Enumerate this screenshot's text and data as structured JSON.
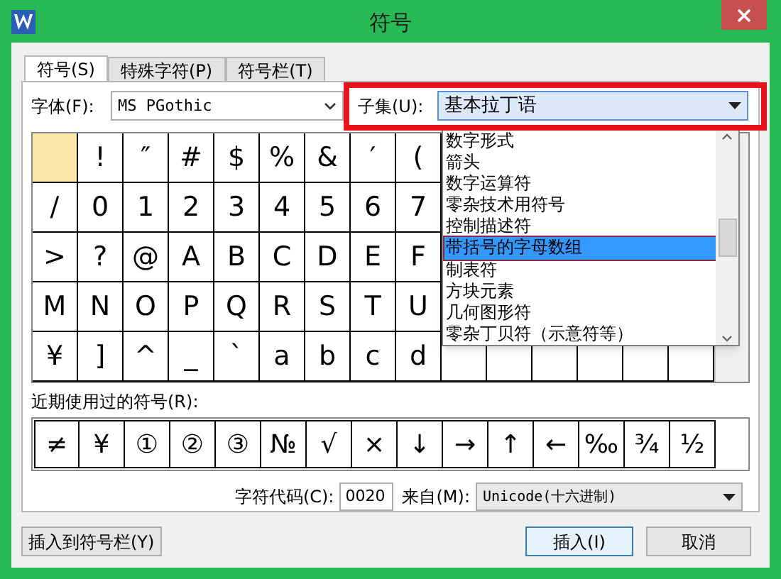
{
  "window": {
    "title": "符号"
  },
  "tabs": [
    {
      "label": "符号(S)",
      "selected": true
    },
    {
      "label": "特殊字符(P)",
      "selected": false
    },
    {
      "label": "符号栏(T)",
      "selected": false
    }
  ],
  "font": {
    "label": "字体(F):",
    "value": "MS PGothic"
  },
  "subset": {
    "label": "子集(U):",
    "value": "基本拉丁语",
    "expanded": true,
    "options": [
      {
        "label": "数字形式",
        "selected": false
      },
      {
        "label": "箭头",
        "selected": false
      },
      {
        "label": "数字运算符",
        "selected": false
      },
      {
        "label": "零杂技术用符号",
        "selected": false
      },
      {
        "label": "控制描述符",
        "selected": false
      },
      {
        "label": "带括号的字母数组",
        "selected": true
      },
      {
        "label": "制表符",
        "selected": false
      },
      {
        "label": "方块元素",
        "selected": false
      },
      {
        "label": "几何图形符",
        "selected": false
      },
      {
        "label": "零杂丁贝符（示意符等）",
        "selected": false
      }
    ]
  },
  "grid": {
    "rows": [
      [
        {
          "selected": true
        },
        {
          "char": "!",
          "selected": false
        },
        {
          "char": "″",
          "selected": false
        },
        {
          "char": "#",
          "selected": false
        },
        {
          "char": "$",
          "selected": false
        },
        {
          "char": "%",
          "selected": false
        },
        {
          "char": "&",
          "selected": false
        },
        {
          "char": "′",
          "selected": false
        },
        {
          "char": "(",
          "selected": false
        }
      ],
      [
        {
          "char": "/",
          "selected": false
        },
        {
          "char": "0",
          "selected": false
        },
        {
          "char": "1",
          "selected": false
        },
        {
          "char": "2",
          "selected": false
        },
        {
          "char": "3",
          "selected": false
        },
        {
          "char": "4",
          "selected": false
        },
        {
          "char": "5",
          "selected": false
        },
        {
          "char": "6",
          "selected": false
        },
        {
          "char": "7",
          "selected": false
        }
      ],
      [
        {
          "char": ">",
          "selected": false
        },
        {
          "char": "?",
          "selected": false
        },
        {
          "char": "@",
          "selected": false
        },
        {
          "char": "A",
          "selected": false
        },
        {
          "char": "B",
          "selected": false
        },
        {
          "char": "C",
          "selected": false
        },
        {
          "char": "D",
          "selected": false
        },
        {
          "char": "E",
          "selected": false
        },
        {
          "char": "F",
          "selected": false
        }
      ],
      [
        {
          "char": "M",
          "selected": false
        },
        {
          "char": "N",
          "selected": false
        },
        {
          "char": "O",
          "selected": false
        },
        {
          "char": "P",
          "selected": false
        },
        {
          "char": "Q",
          "selected": false
        },
        {
          "char": "R",
          "selected": false
        },
        {
          "char": "S",
          "selected": false
        },
        {
          "char": "T",
          "selected": false
        },
        {
          "char": "U",
          "selected": false
        }
      ],
      [
        {
          "char": "¥",
          "selected": false
        },
        {
          "char": "]",
          "selected": false
        },
        {
          "char": "^",
          "selected": false
        },
        {
          "char": "_",
          "selected": false
        },
        {
          "char": "`",
          "selected": false
        },
        {
          "char": "a",
          "selected": false
        },
        {
          "char": "b",
          "selected": false
        },
        {
          "char": "c",
          "selected": false
        },
        {
          "char": "d",
          "selected": false
        }
      ]
    ]
  },
  "recent": {
    "label": "近期使用过的符号(R):",
    "symbols": [
      "≠",
      "¥",
      "①",
      "②",
      "③",
      "№",
      "√",
      "×",
      "↓",
      "→",
      "↑",
      "←",
      "‰",
      "¾",
      "½"
    ]
  },
  "code": {
    "label": "字符代码(C):",
    "value": "0020",
    "from_label": "来自(M):",
    "from_value": "Unicode(十六进制)"
  },
  "buttons": {
    "insert_to_bar": "插入到符号栏(Y)",
    "insert": "插入(I)",
    "cancel": "取消"
  }
}
